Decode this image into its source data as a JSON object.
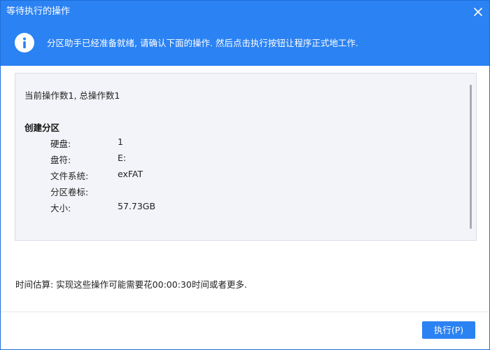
{
  "window": {
    "title": "等待执行的操作"
  },
  "info": {
    "icon": "info-icon",
    "message": "分区助手已经准备就绪, 请确认下面的操作. 然后点击执行按钮让程序正式地工作."
  },
  "operations": {
    "count_text": "当前操作数1, 总操作数1",
    "section_title": "创建分区",
    "details": [
      {
        "label": "硬盘:",
        "value": "1"
      },
      {
        "label": "盘符:",
        "value": "E:"
      },
      {
        "label": "文件系统:",
        "value": "exFAT"
      },
      {
        "label": "分区卷标:",
        "value": ""
      },
      {
        "label": "大小:",
        "value": "57.73GB"
      }
    ]
  },
  "time_estimate": "时间估算: 实现这些操作可能需要花00:00:30时间或者更多.",
  "buttons": {
    "execute": "执行(P)"
  },
  "colors": {
    "accent": "#2b82f3",
    "panel_bg": "#f2f4f9"
  }
}
